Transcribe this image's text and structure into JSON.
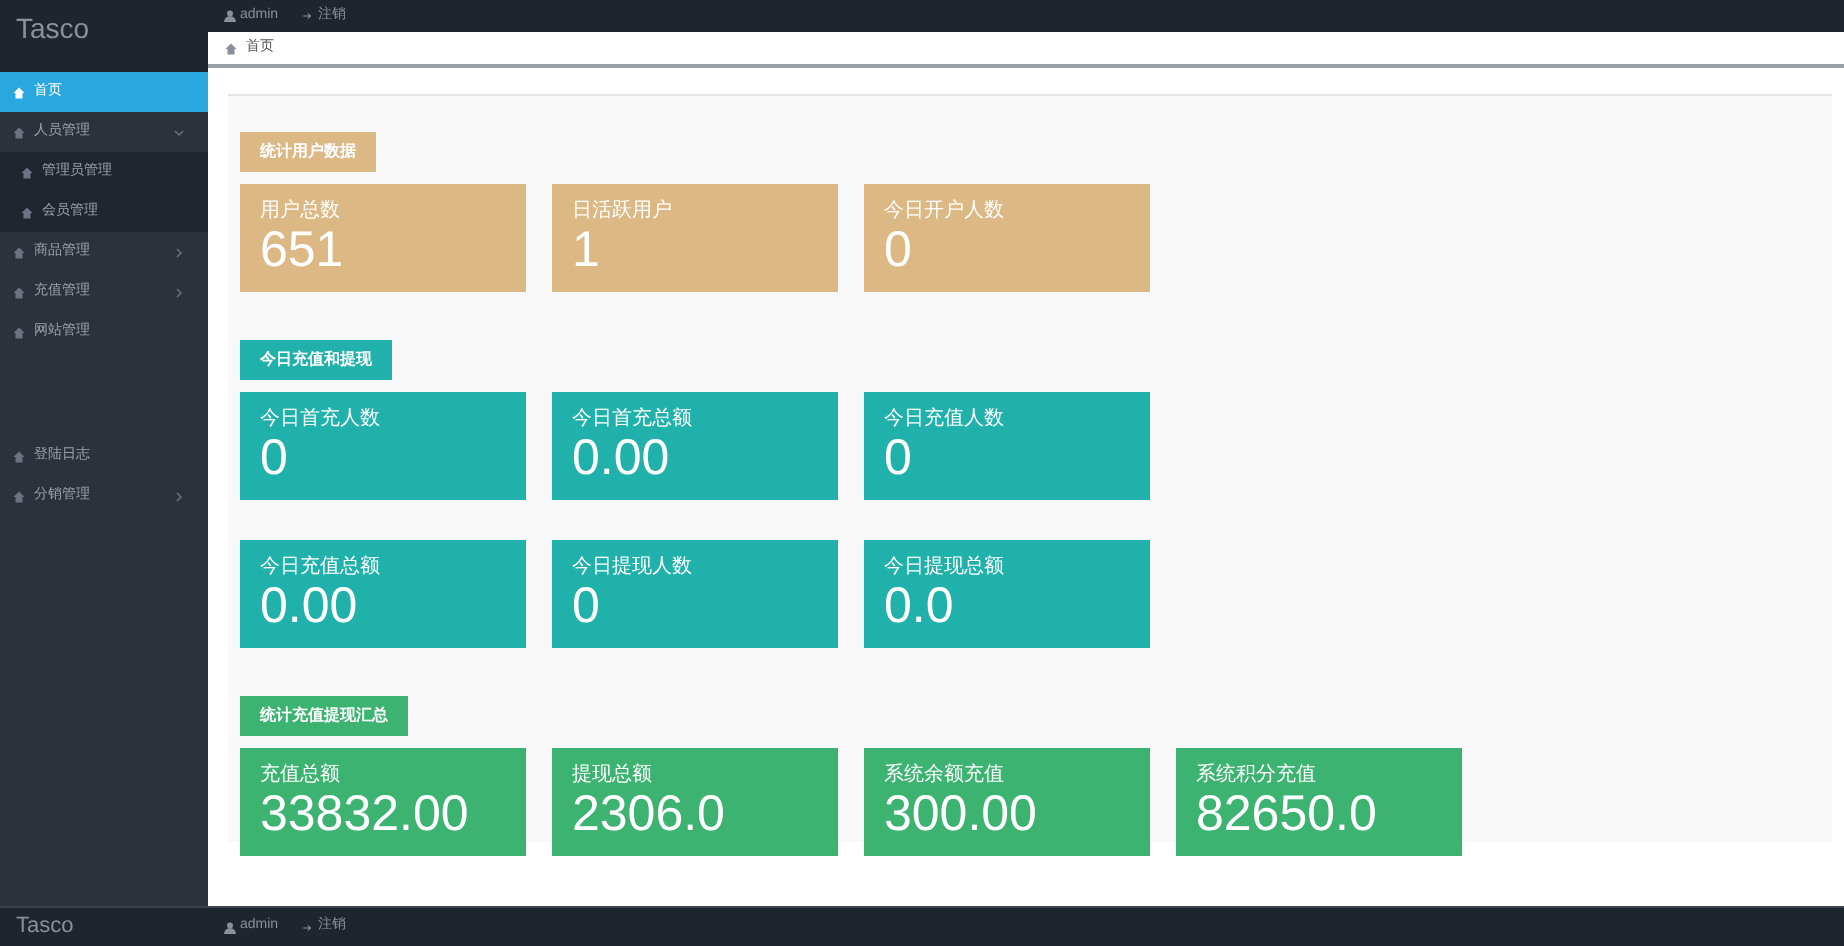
{
  "brand": "Tasco",
  "top_bar": {
    "user": "admin",
    "logout": "注销"
  },
  "sidebar": {
    "items": [
      {
        "label": "首页",
        "selected": true,
        "kind": "link"
      },
      {
        "label": "人员管理",
        "selected": false,
        "kind": "group",
        "expanded": true,
        "children": [
          {
            "label": "管理员管理",
            "selected": false
          },
          {
            "label": "会员管理",
            "selected": false
          }
        ]
      },
      {
        "label": "商品管理",
        "selected": false,
        "kind": "group",
        "expanded": false
      },
      {
        "label": "充值管理",
        "selected": false,
        "kind": "group",
        "expanded": false
      },
      {
        "label": "网站管理",
        "selected": false,
        "kind": "link"
      },
      {
        "label": "登陆日志",
        "selected": false,
        "kind": "link",
        "gap_before": true
      },
      {
        "label": "分销管理",
        "selected": false,
        "kind": "group",
        "expanded": false
      }
    ]
  },
  "breadcrumb": "首页",
  "sections": [
    {
      "title": "统计用户数据",
      "color": "#dcb884",
      "cards": [
        {
          "label": "用户总数",
          "value": "651"
        },
        {
          "label": "日活跃用户",
          "value": "1"
        },
        {
          "label": "今日开户人数",
          "value": "0"
        }
      ]
    },
    {
      "title": "今日充值和提现",
      "color": "#20b2aa",
      "cards": [
        {
          "label": "今日首充人数",
          "value": "0"
        },
        {
          "label": "今日首充总额",
          "value": "0.00"
        },
        {
          "label": "今日充值人数",
          "value": "0"
        },
        {
          "label": "今日充值总额",
          "value": "0.00"
        },
        {
          "label": "今日提现人数",
          "value": "0"
        },
        {
          "label": "今日提现总额",
          "value": "0.0"
        }
      ]
    },
    {
      "title": "统计充值提现汇总",
      "color": "#3cb371",
      "cards": [
        {
          "label": "充值总额",
          "value": "33832.00"
        },
        {
          "label": "提现总额",
          "value": "2306.0"
        },
        {
          "label": "系统余额充值",
          "value": "300.00"
        },
        {
          "label": "系统积分充值",
          "value": "82650.0"
        }
      ]
    }
  ],
  "footer_bar": {
    "brand": "Tasco",
    "user": "admin",
    "logout": "注销"
  }
}
